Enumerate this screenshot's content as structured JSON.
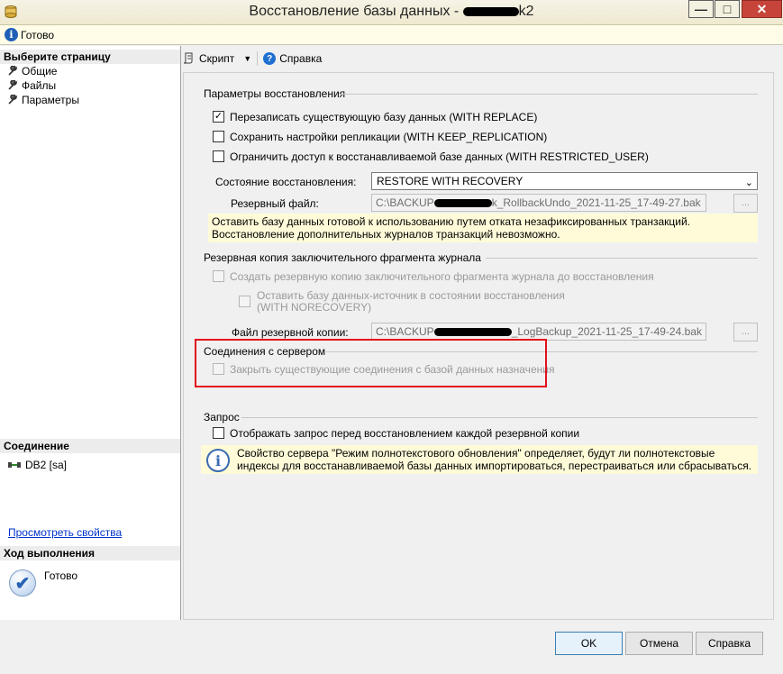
{
  "window": {
    "title": "Восстановление базы данных - ",
    "title_suffix": "k2",
    "minimize_label": "—",
    "maximize_label": "□",
    "close_label": "✕"
  },
  "status": {
    "text": "Готово"
  },
  "left": {
    "select_page_header": "Выберите страницу",
    "pages": [
      {
        "label": "Общие"
      },
      {
        "label": "Файлы"
      },
      {
        "label": "Параметры"
      }
    ],
    "connection_header": "Соединение",
    "connection_value": "DB2 [sa]",
    "view_properties_link": "Просмотреть свойства",
    "progress_header": "Ход выполнения",
    "progress_status": "Готово"
  },
  "toolbar": {
    "script_label": "Скрипт",
    "help_label": "Справка"
  },
  "restore_options": {
    "title": "Параметры восстановления",
    "overwrite": {
      "label": "Перезаписать существующую базу данных (WITH REPLACE)",
      "checked": true
    },
    "keep_replication": {
      "label": "Сохранить настройки репликации (WITH KEEP_REPLICATION)",
      "checked": false
    },
    "restricted_user": {
      "label": "Ограничить доступ к восстанавливаемой базе данных (WITH RESTRICTED_USER)",
      "checked": false
    },
    "recovery_state_label": "Состояние восстановления:",
    "recovery_state_value": "RESTORE WITH RECOVERY",
    "standby_file_label": "Резервный файл:",
    "standby_file_prefix": "C:\\BACKUP",
    "standby_file_suffix": "k_RollbackUndo_2021-11-25_17-49-27.bak",
    "browse_label": "...",
    "note": "Оставить базу данных готовой к использованию путем отката незафиксированных транзакций. Восстановление дополнительных журналов транзакций невозможно."
  },
  "tail_log": {
    "title": "Резервная копия заключительного фрагмента журнала",
    "take_tail": {
      "label": "Создать резервную копию заключительного фрагмента журнала до восстановления",
      "checked": false
    },
    "norecovery": {
      "label_line1": "Оставить базу данных-источник в состоянии восстановления",
      "label_line2": "(WITH NORECOVERY)",
      "checked": false
    },
    "backup_file_label": "Файл резервной копии:",
    "backup_file_prefix": "C:\\BACKUP",
    "backup_file_suffix": "_LogBackup_2021-11-25_17-49-24.bak",
    "browse_label": "..."
  },
  "server_connections": {
    "title": "Соединения с сервером",
    "close_existing": {
      "label": "Закрыть существующие соединения с базой данных назначения",
      "checked": false
    }
  },
  "prompt": {
    "title": "Запрос",
    "prompt_before": {
      "label": "Отображать запрос перед восстановлением каждой резервной копии",
      "checked": false
    },
    "info_note": "Свойство сервера \"Режим полнотекстового обновления\" определяет, будут ли полнотекстовые индексы для восстанавливаемой базы данных импортироваться, перестраиваться или сбрасываться."
  },
  "buttons": {
    "ok": "OK",
    "cancel": "Отмена",
    "help": "Справка"
  }
}
